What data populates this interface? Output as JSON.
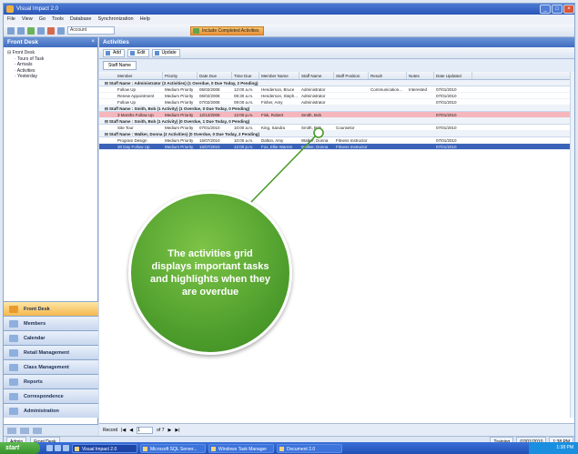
{
  "window": {
    "title": "Visual Impact 2.0"
  },
  "menubar": {
    "items": [
      "File",
      "View",
      "Go",
      "Tools",
      "Database",
      "Synchronization",
      "Help"
    ]
  },
  "toolbar": {
    "search_value": "Account",
    "banner_label": "Include Completed Activities"
  },
  "left_pane": {
    "title": "Front Desk",
    "tree": [
      "Front Desk",
      "Tours of Task",
      "Arrivals",
      "Activities",
      "Yesterday"
    ]
  },
  "nav": {
    "items": [
      {
        "label": "Front Desk",
        "active": true
      },
      {
        "label": "Members",
        "active": false
      },
      {
        "label": "Calendar",
        "active": false
      },
      {
        "label": "Retail Management",
        "active": false
      },
      {
        "label": "Class Management",
        "active": false
      },
      {
        "label": "Reports",
        "active": false
      },
      {
        "label": "Correspondence",
        "active": false
      },
      {
        "label": "Administration",
        "active": false
      }
    ]
  },
  "main": {
    "title": "Activities",
    "toolbar": [
      "Add",
      "Edit",
      "Update"
    ],
    "groupby": "Staff Name",
    "columns": [
      "Member",
      "Priority",
      "Date Due",
      "Time Due",
      "Member Name",
      "Staff Name",
      "Staff Position",
      "Result",
      "Notes",
      "Date Updated"
    ],
    "groups": [
      {
        "label": "Staff Name : Administrator (3 Activities) (1 Overdue, 0 Due Today, 2 Pending)",
        "rows": [
          {
            "cells": [
              "Follow Up",
              "Medium Priority",
              "06/02/2008",
              "12:00 a.m.",
              "Henderson, Bruce",
              "Administrator",
              "",
              "Communication...",
              "Interested",
              "07/01/2010"
            ],
            "state": "normal"
          },
          {
            "cells": [
              "Renew Appointment",
              "Medium Priority",
              "06/02/2008",
              "08:30 a.m.",
              "Henderson, Steph...",
              "Administrator",
              "",
              "",
              "",
              "07/01/2010"
            ],
            "state": "normal"
          },
          {
            "cells": [
              "Follow Up",
              "Medium Priority",
              "07/02/2008",
              "09:00 a.m.",
              "Fisher, Amy",
              "Administrator",
              "",
              "",
              "",
              "07/01/2010"
            ],
            "state": "normal"
          }
        ]
      },
      {
        "label": "Staff Name : Smith, Bob (1 Activity) (1 Overdue, 0 Due Today, 0 Pending)",
        "rows": [
          {
            "cells": [
              "3 Months Follow Up",
              "Medium Priority",
              "12/12/2009",
              "12:00 p.m.",
              "Fisk, Robert",
              "Smith, Bob",
              "",
              "",
              "",
              "07/01/2010"
            ],
            "state": "overdue"
          }
        ]
      },
      {
        "label": "Staff Name : Smith, Bob (1 Activity) (0 Overdue, 1 Due Today, 0 Pending)",
        "rows": [
          {
            "cells": [
              "Site Tour",
              "Medium Priority",
              "07/01/2010",
              "10:00 a.m.",
              "King, Sandra",
              "Smith, Bob",
              "Counselor",
              "",
              "",
              "07/01/2010"
            ],
            "state": "normal"
          }
        ]
      },
      {
        "label": "Staff Name : Walker, Donna (2 Activities) (0 Overdue, 0 Due Today, 2 Pending)",
        "rows": [
          {
            "cells": [
              "Program Design",
              "Medium Priority",
              "15/07/2010",
              "10:00 a.m.",
              "Dalton, Amy",
              "Walker, Donna",
              "Fitness Instructor",
              "",
              "",
              "07/01/2010"
            ],
            "state": "normal"
          },
          {
            "cells": [
              "30 Day Follow Up",
              "Medium Priority",
              "15/07/2010",
              "12:00 p.m.",
              "Fox, Ellie Warren",
              "Walker, Donna",
              "Fitness Instructor",
              "",
              "",
              "07/01/2010"
            ],
            "state": "selected"
          }
        ]
      }
    ],
    "pager_label": "Record",
    "pager_value": "1",
    "pager_total": "of 7"
  },
  "app_status": {
    "left": [
      "Admin",
      "Front Desk"
    ],
    "right": [
      "Training",
      "07/01/2010",
      "1:38 PM"
    ]
  },
  "taskbar": {
    "start_label": "start",
    "tasks": [
      "Visual Impact 2.0",
      "Microsoft SQL Server...",
      "Windows Task Manager",
      "Document 2.0"
    ],
    "tray_time": "1:38 PM"
  },
  "callout": {
    "text": "The activities grid displays important tasks and highlights when they are overdue"
  },
  "colors": {
    "callout": "#4a9a2a",
    "overdue_row": "#f5b7bd",
    "selected_row": "#3a63b8"
  }
}
